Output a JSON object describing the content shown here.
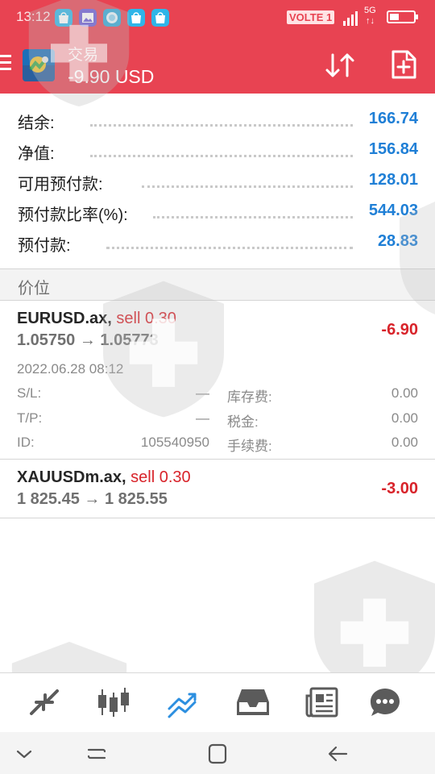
{
  "status_bar": {
    "time": "13:12",
    "volte": "VOLTE 1",
    "network": "5G",
    "network_arrows": "↑↓",
    "notification_icons": [
      "bag-icon",
      "gallery-icon",
      "browser-icon",
      "bag-icon",
      "bag-icon"
    ],
    "battery_level": 0.35
  },
  "toolbar": {
    "title": "交易",
    "subtitle": "-9.90 USD",
    "icons": [
      "menu-icon",
      "metatrader-logo",
      "sort-icon",
      "new-order-icon"
    ]
  },
  "summary": {
    "rows": [
      {
        "label": "结余:",
        "value": "166.74"
      },
      {
        "label": "净值:",
        "value": "156.84"
      },
      {
        "label": "可用预付款:",
        "value": "128.01"
      },
      {
        "label": "预付款比率(%):",
        "value": "544.03"
      },
      {
        "label": "预付款:",
        "value": "28.83"
      }
    ]
  },
  "section": {
    "title": "价位"
  },
  "positions": [
    {
      "symbol": "EURUSD.ax,",
      "side": "sell 0.30",
      "prices": "1.05750 → 1.05773",
      "profit": "-6.90",
      "time": "2022.06.28 08:12",
      "sl_label": "S/L:",
      "sl_value": "—",
      "tp_label": "T/P:",
      "tp_value": "—",
      "id_label": "ID:",
      "id_value": "105540950",
      "swap_label": "库存费:",
      "swap_value": "0.00",
      "tax_label": "税金:",
      "tax_value": "0.00",
      "commission_label": "手续费:",
      "commission_value": "0.00"
    },
    {
      "symbol": "XAUUSDm.ax,",
      "side": "sell 0.30",
      "prices": "1 825.45 → 1 825.55",
      "profit": "-3.00"
    }
  ],
  "bottom_nav": [
    "quotes-icon",
    "chart-icon",
    "trade-icon",
    "history-icon",
    "news-icon",
    "chat-icon"
  ],
  "system_nav": [
    "chevron-down-icon",
    "menu-lines-icon",
    "home-icon",
    "back-icon"
  ],
  "colors": {
    "header": "#e84352",
    "value_blue": "#1f7fd6",
    "loss_red": "#d8232a",
    "active_nav": "#2c8fe0"
  }
}
